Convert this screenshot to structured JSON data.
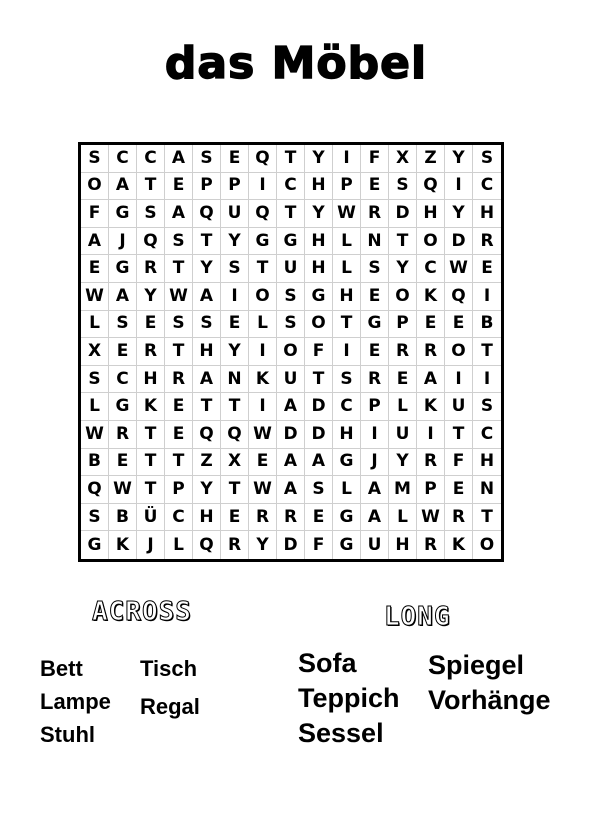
{
  "title": "das Möbel",
  "grid": [
    "SCCASEQTYIFXZYS",
    "OATEPPICHPESQIC",
    "FGSAQUQTYWRDHYH",
    "AJQSTYGGHLNTODR",
    "EGRTYSTUHLSYCWE",
    "WAYWAIOSGHEOKQI",
    "LSESSELSOTGPEEB",
    "XERTHYIOFIERROT",
    "SCHRANKUTSREAII",
    "LGKETTIADCPLKUS",
    "WRTEQQWDDHIUITC",
    "BETTZXEAAGJYRFH",
    "QWTPYTWASLAMPEN",
    "SBÜCHERREGALWRT",
    "GKJLQRYDFGUHRKO"
  ],
  "headings": {
    "across": "ACROSS",
    "long": "LONG"
  },
  "across_words": [
    "Bett",
    "Tisch",
    "Lampe",
    "Regal",
    "Stuhl"
  ],
  "long_words": [
    "Sofa",
    "Spiegel",
    "Teppich",
    "Vorhänge",
    "Sessel"
  ]
}
